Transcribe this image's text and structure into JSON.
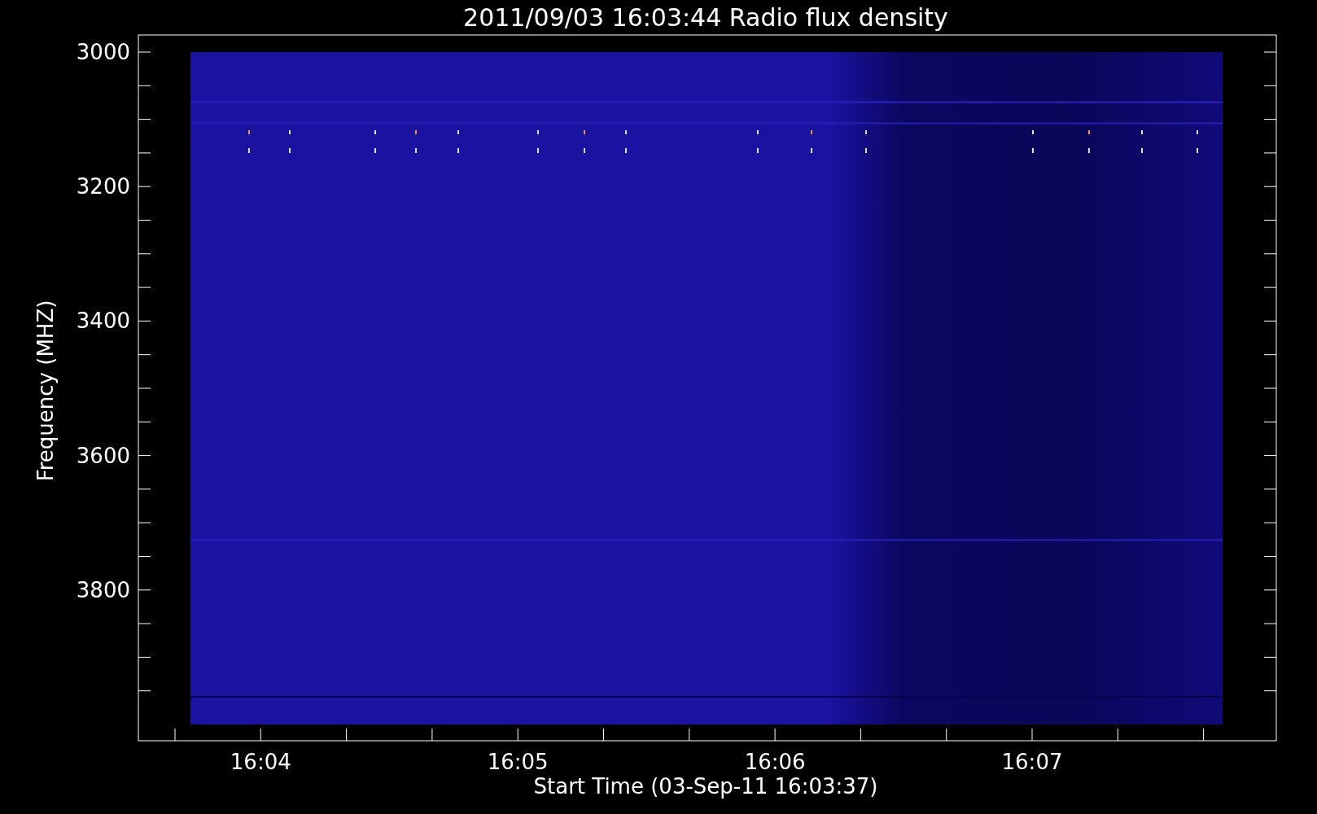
{
  "title": "2011/09/03 16:03:44 Radio flux density",
  "xlabel": "Start Time (03-Sep-11 16:03:37)",
  "ylabel": "Frequency (MHZ)",
  "y_tick_labels": [
    "3000",
    "3200",
    "3400",
    "3600",
    "3800"
  ],
  "x_tick_labels": [
    "16:04",
    "16:05",
    "16:06",
    "16:07"
  ]
}
